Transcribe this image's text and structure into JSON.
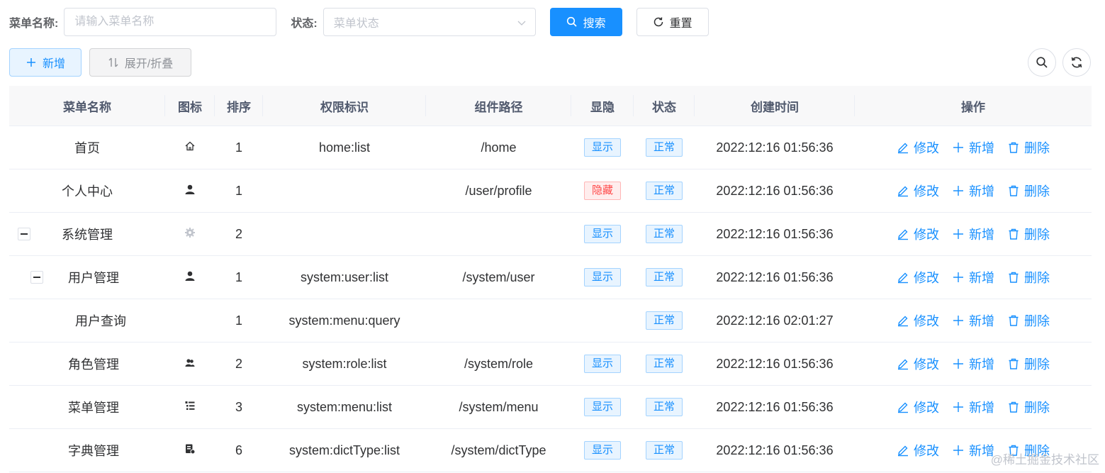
{
  "search": {
    "name_label": "菜单名称:",
    "name_placeholder": "请输入菜单名称",
    "status_label": "状态:",
    "status_placeholder": "菜单状态",
    "search_button": "搜索",
    "reset_button": "重置"
  },
  "toolbar": {
    "add_button": "新增",
    "expand_button": "展开/折叠"
  },
  "table": {
    "headers": {
      "name": "菜单名称",
      "icon": "图标",
      "sort": "排序",
      "perm": "权限标识",
      "path": "组件路径",
      "visible": "显隐",
      "status": "状态",
      "time": "创建时间",
      "ops": "操作"
    },
    "rows": [
      {
        "name": "首页",
        "icon": "home-icon",
        "sort": "1",
        "perm": "home:list",
        "path": "/home",
        "visible": "显示",
        "status": "正常",
        "time": "2022:12:16 01:56:36"
      },
      {
        "name": "个人中心",
        "icon": "user-icon",
        "sort": "1",
        "perm": "",
        "path": "/user/profile",
        "visible": "隐藏",
        "status": "正常",
        "time": "2022:12:16 01:56:36"
      },
      {
        "name": "系统管理",
        "icon": "gear-icon",
        "sort": "2",
        "perm": "",
        "path": "",
        "visible": "显示",
        "status": "正常",
        "time": "2022:12:16 01:56:36"
      },
      {
        "name": "用户管理",
        "icon": "user-icon",
        "sort": "1",
        "perm": "system:user:list",
        "path": "/system/user",
        "visible": "显示",
        "status": "正常",
        "time": "2022:12:16 01:56:36"
      },
      {
        "name": "用户查询",
        "icon": "",
        "sort": "1",
        "perm": "system:menu:query",
        "path": "",
        "visible": "",
        "status": "正常",
        "time": "2022:12:16 02:01:27"
      },
      {
        "name": "角色管理",
        "icon": "role-icon",
        "sort": "2",
        "perm": "system:role:list",
        "path": "/system/role",
        "visible": "显示",
        "status": "正常",
        "time": "2022:12:16 01:56:36"
      },
      {
        "name": "菜单管理",
        "icon": "list-icon",
        "sort": "3",
        "perm": "system:menu:list",
        "path": "/system/menu",
        "visible": "显示",
        "status": "正常",
        "time": "2022:12:16 01:56:36"
      },
      {
        "name": "字典管理",
        "icon": "dict-icon",
        "sort": "6",
        "perm": "system:dictType:list",
        "path": "/system/dictType",
        "visible": "显示",
        "status": "正常",
        "time": "2022:12:16 01:56:36"
      }
    ],
    "ops": {
      "edit": "修改",
      "add": "新增",
      "delete": "删除"
    }
  },
  "watermark": "@稀土掘金技术社区",
  "colors": {
    "primary": "#1890ff",
    "danger": "#ff4949",
    "header_bg": "#f8f8f9"
  }
}
